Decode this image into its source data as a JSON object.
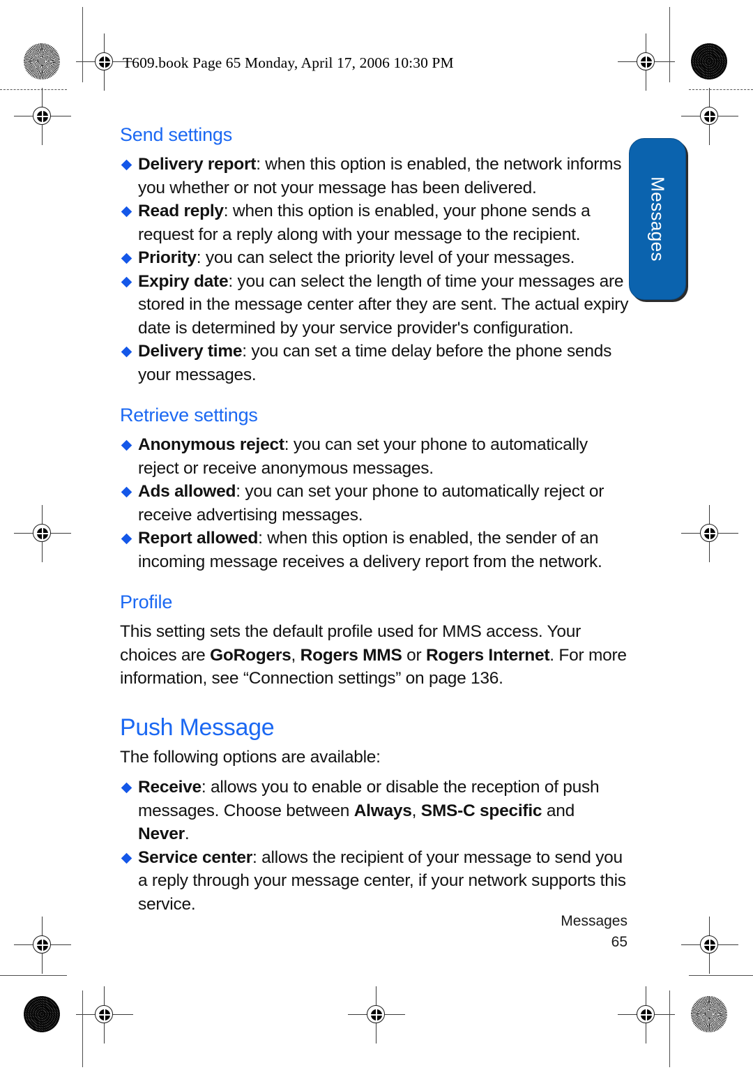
{
  "document": {
    "running_header": "T609.book  Page 65  Monday, April 17, 2006  10:30 PM",
    "heading_color": "#1b68f2",
    "bullet_color": "#1457e8",
    "tab_color": "#0b63ae"
  },
  "side_tab": {
    "label": "Messages"
  },
  "sections": {
    "send_settings": {
      "heading": "Send settings",
      "bullets": [
        {
          "term": "Delivery report",
          "text": ": when this option is enabled, the network informs you whether or not your message has been delivered."
        },
        {
          "term": "Read reply",
          "text": ": when this option is enabled, your phone sends a request for a reply along with your message to the recipient."
        },
        {
          "term": "Priority",
          "text": ": you can select the priority level of your messages."
        },
        {
          "term": "Expiry date",
          "text": ": you can select the length of time your messages are stored in the message center after they are sent. The actual expiry date is determined by your service provider's configuration."
        },
        {
          "term": "Delivery time",
          "text": ": you can set a time delay before the phone sends your messages."
        }
      ]
    },
    "retrieve_settings": {
      "heading": "Retrieve settings",
      "bullets": [
        {
          "term": "Anonymous reject",
          "text": ": you can set your phone to automatically reject or receive anonymous messages."
        },
        {
          "term": "Ads allowed",
          "text": ": you can set your phone to automatically reject or receive advertising messages."
        },
        {
          "term": "Report allowed",
          "text": ": when this option is enabled, the sender of an incoming message receives a delivery report from the network."
        }
      ]
    },
    "profile": {
      "heading": "Profile",
      "paragraph_part1": "This setting sets the default profile used for MMS access. Your choices are ",
      "choice1": "GoRogers",
      "sep1": ", ",
      "choice2": "Rogers MMS",
      "sep2": " or ",
      "choice3": "Rogers Internet",
      "paragraph_part2": ". For more information, see “Connection settings” on page 136."
    },
    "push_message": {
      "heading": "Push Message",
      "intro": "The following options are available:",
      "receive": {
        "term": "Receive",
        "text_part1": ": allows you to enable or disable the reception of push messages. Choose between ",
        "option1": "Always",
        "sep1": ", ",
        "option2": "SMS-C specific",
        "sep2": " and ",
        "option3": "Never",
        "text_part2": "."
      },
      "service_center": {
        "term": "Service center",
        "text": ": allows the recipient of your message to send you a reply through your message center, if your network supports this service."
      }
    }
  },
  "footer": {
    "chapter": "Messages",
    "page_number": "65"
  }
}
